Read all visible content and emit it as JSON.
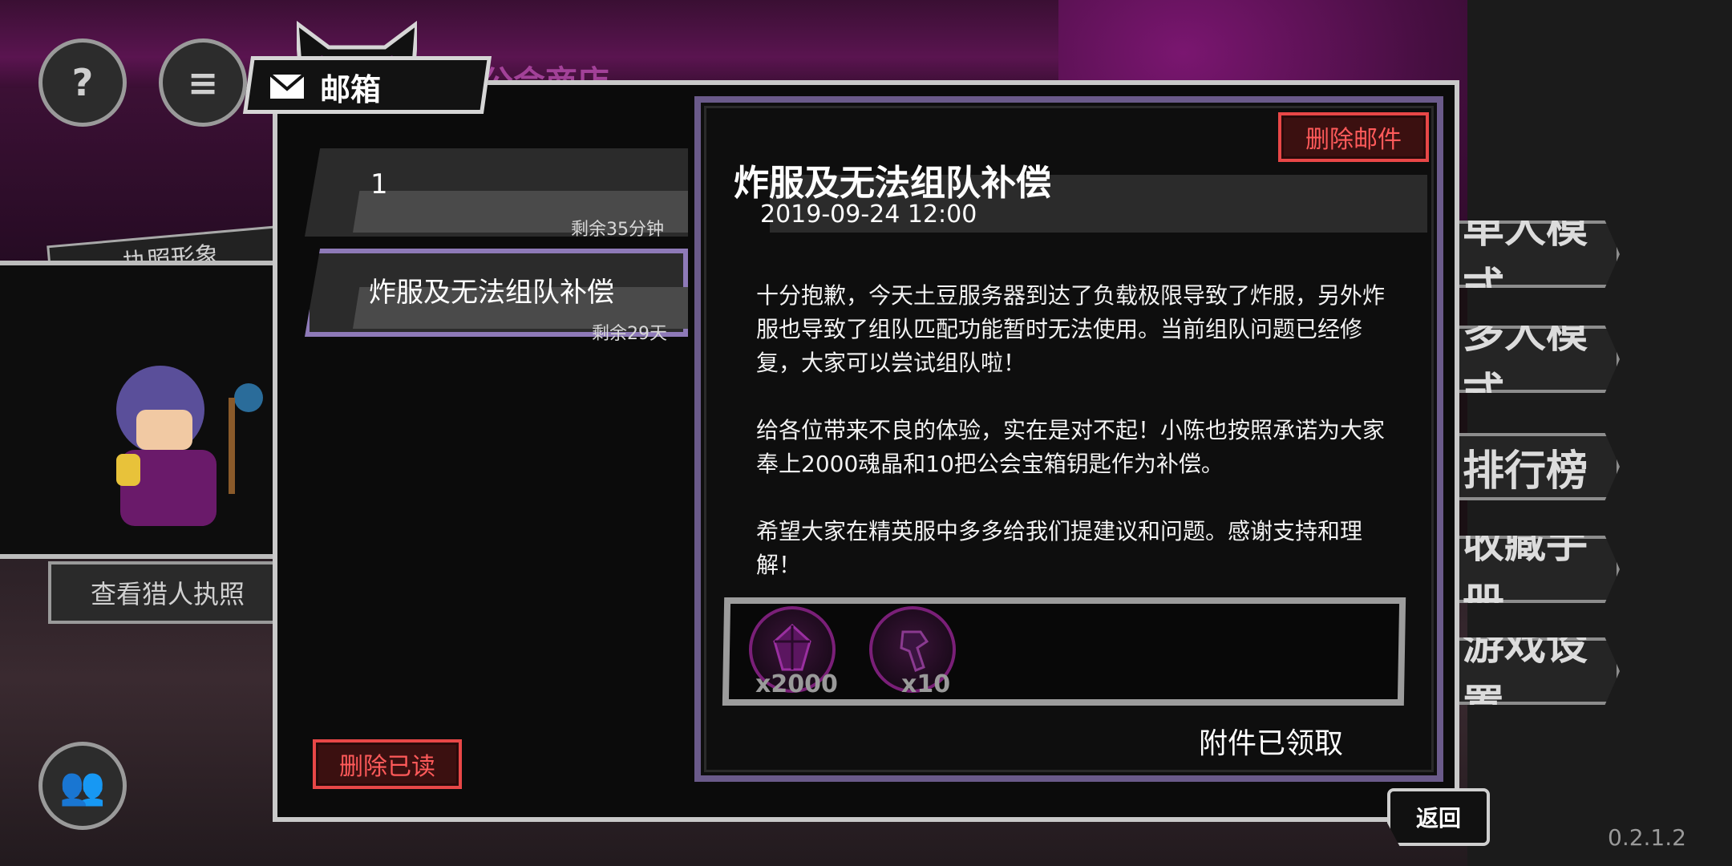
{
  "background": {
    "guild_shop_label": "公会商店",
    "license_label": "执照形象",
    "view_license_button": "查看猎人执照",
    "side_menu": [
      "单人模式",
      "多人模式",
      "排行榜",
      "收藏手册",
      "游戏设置"
    ],
    "version": "0.2.1.2"
  },
  "mailbox": {
    "title": "邮箱",
    "delete_read_label": "删除已读",
    "back_label": "返回",
    "mails": [
      {
        "title": "1",
        "remaining": "剩余35分钟",
        "selected": false
      },
      {
        "title": "炸服及无法组队补偿",
        "remaining": "剩余29天",
        "selected": true
      }
    ]
  },
  "detail": {
    "delete_label": "删除邮件",
    "title": "炸服及无法组队补偿",
    "date": "2019-09-24 12:00",
    "body": "十分抱歉，今天土豆服务器到达了负载极限导致了炸服，另外炸\n服也导致了组队匹配功能暂时无法使用。当前组队问题已经修\n复，大家可以尝试组队啦！\n\n给各位带来不良的体验，实在是对不起！小陈也按照承诺为大家\n奉上2000魂晶和10把公会宝箱钥匙作为补偿。\n\n希望大家在精英服中多多给我们提建议和问题。感谢支持和理\n解！",
    "attachments": [
      {
        "icon": "soul-crystal-icon",
        "qty": "x2000"
      },
      {
        "icon": "guild-key-icon",
        "qty": "x10"
      }
    ],
    "claimed_label": "附件已领取"
  },
  "colors": {
    "accent_purple": "#8e7ab8",
    "delete_red": "#e84747",
    "item_ring": "#7a1f78"
  }
}
